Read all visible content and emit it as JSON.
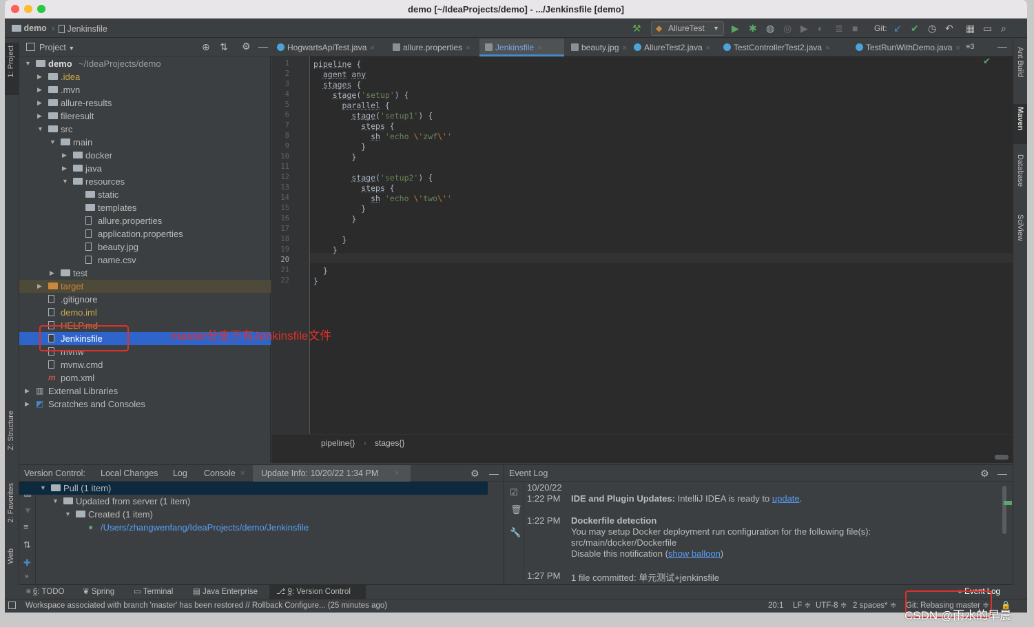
{
  "window": {
    "title": "demo [~/IdeaProjects/demo] - .../Jenkinsfile [demo]"
  },
  "nav": {
    "project": "demo",
    "file": "Jenkinsfile",
    "run_config": "AllureTest",
    "git_label": "Git:"
  },
  "left_strip": {
    "project": "1: Project",
    "structure": "Z: Structure",
    "favorites": "2: Favorites",
    "web": "Web"
  },
  "right_strip": {
    "ant": "Ant Build",
    "maven": "Maven",
    "database": "Database",
    "sciview": "SciView"
  },
  "project_panel": {
    "title": "Project",
    "tree": [
      {
        "label": "demo",
        "suffix": "~/IdeaProjects/demo",
        "depth": 0,
        "arrow": "▼",
        "icon": "folder"
      },
      {
        "label": ".idea",
        "depth": 1,
        "arrow": "▶",
        "icon": "folder",
        "color": "#c8a94a"
      },
      {
        "label": ".mvn",
        "depth": 1,
        "arrow": "▶",
        "icon": "folder"
      },
      {
        "label": "allure-results",
        "depth": 1,
        "arrow": "▶",
        "icon": "folder"
      },
      {
        "label": "fileresult",
        "depth": 1,
        "arrow": "▶",
        "icon": "folder"
      },
      {
        "label": "src",
        "depth": 1,
        "arrow": "▼",
        "icon": "folder"
      },
      {
        "label": "main",
        "depth": 2,
        "arrow": "▼",
        "icon": "folder"
      },
      {
        "label": "docker",
        "depth": 3,
        "arrow": "▶",
        "icon": "folder"
      },
      {
        "label": "java",
        "depth": 3,
        "arrow": "▶",
        "icon": "folder"
      },
      {
        "label": "resources",
        "depth": 3,
        "arrow": "▼",
        "icon": "folder"
      },
      {
        "label": "static",
        "depth": 4,
        "arrow": "",
        "icon": "folder"
      },
      {
        "label": "templates",
        "depth": 4,
        "arrow": "",
        "icon": "folder"
      },
      {
        "label": "allure.properties",
        "depth": 4,
        "arrow": "",
        "icon": "file"
      },
      {
        "label": "application.properties",
        "depth": 4,
        "arrow": "",
        "icon": "file"
      },
      {
        "label": "beauty.jpg",
        "depth": 4,
        "arrow": "",
        "icon": "file"
      },
      {
        "label": "name.csv",
        "depth": 4,
        "arrow": "",
        "icon": "file"
      },
      {
        "label": "test",
        "depth": 2,
        "arrow": "▶",
        "icon": "folder"
      },
      {
        "label": "target",
        "depth": 1,
        "arrow": "▶",
        "icon": "folder-orange",
        "color": "#c8873d"
      },
      {
        "label": ".gitignore",
        "depth": 1,
        "arrow": "",
        "icon": "file"
      },
      {
        "label": "demo.iml",
        "depth": 1,
        "arrow": "",
        "icon": "file",
        "color": "#c8a94a"
      },
      {
        "label": "HELP.md",
        "depth": 1,
        "arrow": "",
        "icon": "file",
        "color": "#c8873d"
      },
      {
        "label": "Jenkinsfile",
        "depth": 1,
        "arrow": "",
        "icon": "file",
        "selected": true
      },
      {
        "label": "mvnw",
        "depth": 1,
        "arrow": "",
        "icon": "file"
      },
      {
        "label": "mvnw.cmd",
        "depth": 1,
        "arrow": "",
        "icon": "file"
      },
      {
        "label": "pom.xml",
        "depth": 1,
        "arrow": "",
        "icon": "maven"
      },
      {
        "label": "External Libraries",
        "depth": 0,
        "arrow": "▶",
        "icon": "lib"
      },
      {
        "label": "Scratches and Consoles",
        "depth": 0,
        "arrow": "▶",
        "icon": "scratch"
      }
    ]
  },
  "annotation": {
    "text": "master分支下有Jenkinsfile文件"
  },
  "editor": {
    "tabs": [
      {
        "label": "HogwartsApiTest.java",
        "active": false
      },
      {
        "label": "allure.properties",
        "active": false
      },
      {
        "label": "Jenkinsfile",
        "active": true
      },
      {
        "label": "beauty.jpg",
        "active": false
      },
      {
        "label": "AllureTest2.java",
        "active": false
      },
      {
        "label": "TestControllerTest2.java",
        "active": false
      },
      {
        "label": "TestRunWithDemo.java",
        "active": false
      }
    ],
    "tabs_overflow": "≡3",
    "lines": [
      "pipeline {",
      "  agent any",
      "  stages {",
      "    stage('setup') {",
      "      parallel {",
      "        stage('setup1') {",
      "          steps {",
      "            sh 'echo \\'zwf\\''",
      "          }",
      "        }",
      "",
      "        stage('setup2') {",
      "          steps {",
      "            sh 'echo \\'two\\''",
      "          }",
      "        }",
      "",
      "      }",
      "    }",
      "",
      "  }",
      "}"
    ],
    "current_line": 20,
    "breadcrumb": [
      "pipeline{}",
      "stages{}"
    ]
  },
  "version_control": {
    "label": "Version Control:",
    "tabs": [
      "Local Changes",
      "Log",
      "Console",
      "Update Info: 10/20/22 1:34 PM"
    ],
    "tree": [
      {
        "label": "Pull (1 item)",
        "depth": 0,
        "arrow": "▼"
      },
      {
        "label": "Updated from server (1 item)",
        "depth": 1,
        "arrow": "▼"
      },
      {
        "label": "Created (1 item)",
        "depth": 2,
        "arrow": "▼"
      },
      {
        "label": "/Users/zhangwenfang/IdeaProjects/demo/Jenkinsfile",
        "depth": 3,
        "arrow": "",
        "link": true
      }
    ]
  },
  "event_log": {
    "title": "Event Log",
    "date": "10/20/22",
    "entries": [
      {
        "time": "1:22 PM",
        "bold": "IDE and Plugin Updates:",
        "text": " IntelliJ IDEA is ready to ",
        "link": "update",
        "tail": "."
      },
      {
        "time": "1:22 PM",
        "bold": "Dockerfile detection",
        "lines": [
          "You may setup Docker deployment run configuration for the following file(s):",
          "src/main/docker/Dockerfile"
        ],
        "notif_prefix": "Disable this notification (",
        "notif_link": "show balloon",
        "notif_suffix": ")"
      },
      {
        "time": "1:27 PM",
        "text": "1 file committed: 单元测试+jenkinsfile"
      }
    ]
  },
  "tool_windows": [
    {
      "num": "6",
      "label": ": TODO"
    },
    {
      "num": "",
      "label": "Spring"
    },
    {
      "num": "",
      "label": "Terminal"
    },
    {
      "num": "",
      "label": "Java Enterprise"
    },
    {
      "num": "9",
      "label": ": Version Control"
    }
  ],
  "event_log_button": "Event Log",
  "status": {
    "message": "Workspace associated with branch 'master' has been restored // Rollback Configure... (25 minutes ago)",
    "position": "20:1",
    "line_sep": "LF ≑",
    "encoding": "UTF-8 ≑",
    "indent": "2 spaces* ≑",
    "git": "Git: Rebasing master ≑"
  },
  "watermark": "CSDN @雨水的早晨",
  "colors": {
    "selection": "#2f65ca",
    "annotation_red": "#e0302a",
    "link": "#589df6"
  }
}
